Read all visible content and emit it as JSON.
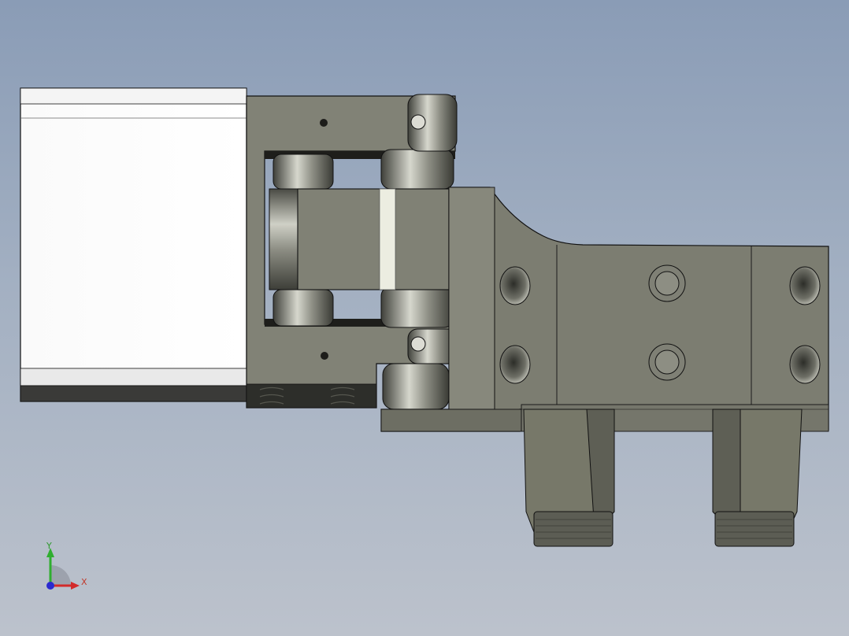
{
  "viewport": {
    "background_top": "#8a9cb6",
    "background_bottom": "#bcc2cc"
  },
  "model": {
    "description_icon": "gripper-assembly-3d-model",
    "face_color": "#7e7f74",
    "highlight_color": "#f2f2f0",
    "edge_color": "#111111"
  },
  "triad": {
    "x_label": "X",
    "y_label": "Y",
    "x_color": "#d22a2a",
    "y_color": "#2fae2f",
    "z_color": "#2a2acf"
  }
}
